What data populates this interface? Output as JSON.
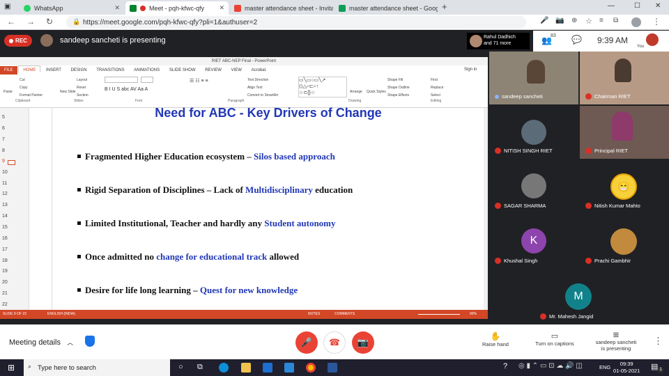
{
  "browser": {
    "tabs": [
      {
        "label": "WhatsApp",
        "active": false
      },
      {
        "label": "Meet - pqh-kfwc-qfy",
        "active": true
      },
      {
        "label": "master attendance sheet - Invita",
        "active": false
      },
      {
        "label": "master attendance sheet - Goog",
        "active": false
      }
    ],
    "url": "https://meet.google.com/pqh-kfwc-qfy?pli=1&authuser=2",
    "new_tab_symbol": "+"
  },
  "meet_top": {
    "rec_label": "REC",
    "presenting_text": "sandeep sancheti is presenting",
    "others_line1": "Rahul Dadhich",
    "others_line2": "and 71 more",
    "participant_count": "83",
    "time": "9:39 AM",
    "you_label": "You"
  },
  "powerpoint": {
    "window_title": "RIET ABC-NEP Final - PowerPoint",
    "sign_in": "Sign in",
    "ribbon_tabs": [
      "FILE",
      "HOME",
      "INSERT",
      "DESIGN",
      "TRANSITIONS",
      "ANIMATIONS",
      "SLIDE SHOW",
      "REVIEW",
      "VIEW",
      "Acrobat"
    ],
    "groups": [
      "Clipboard",
      "Slides",
      "Font",
      "Paragraph",
      "Drawing",
      "Editing"
    ],
    "clipboard_items": [
      "Paste",
      "Cut",
      "Copy",
      "Format Painter"
    ],
    "slides_items": [
      "New Slide",
      "Layout",
      "Reset",
      "Section"
    ],
    "paragraph_items": [
      "Text Direction",
      "Align Text",
      "Convert to SmartArt"
    ],
    "drawing_items": [
      "Arrange",
      "Quick Styles",
      "Shape Fill",
      "Shape Outline",
      "Shape Effects"
    ],
    "editing_items": [
      "Find",
      "Replace",
      "Select"
    ],
    "thumb_numbers": [
      "5",
      "6",
      "7",
      "8",
      "9",
      "10",
      "11",
      "12",
      "13",
      "14",
      "15",
      "16",
      "17",
      "18",
      "19",
      "20",
      "21",
      "22"
    ],
    "slide": {
      "title": "Need for ABC - Key Drivers of Change",
      "bullets": [
        {
          "plain": "Fragmented Higher Education ecosystem – ",
          "highlight": "Silos based approach",
          "after": ""
        },
        {
          "plain": "Rigid Separation of Disciplines – Lack of ",
          "highlight": "Multidisciplinary",
          "after": " education"
        },
        {
          "plain": "Limited Institutional, Teacher and hardly any ",
          "highlight": "Student autonomy",
          "after": ""
        },
        {
          "plain": "Once admitted no ",
          "highlight": "change for educational track",
          "after": " allowed"
        },
        {
          "plain": "Desire for life long learning – ",
          "highlight": "Quest for new knowledge",
          "after": ""
        }
      ]
    },
    "status": {
      "slide_of": "SLIDE 9 OF 23",
      "language": "ENGLISH (INDIA)",
      "notes": "NOTES",
      "comments": "COMMENTS",
      "zoom": "90%"
    }
  },
  "participants": [
    {
      "name": "sandeep sancheti",
      "muted": false,
      "avatar": "video"
    },
    {
      "name": "Chairman RIET",
      "muted": true,
      "avatar": "video"
    },
    {
      "name": "NITISH SINGH RIET",
      "muted": true,
      "avatar": "photo"
    },
    {
      "name": "Principal RIET",
      "muted": true,
      "avatar": "video"
    },
    {
      "name": "SAGAR SHARMA",
      "muted": true,
      "avatar": "photo"
    },
    {
      "name": "Nitish Kumar Mahto",
      "muted": true,
      "avatar": "emoji"
    },
    {
      "name": "Khushal Singh",
      "muted": true,
      "avatar": "letter",
      "letter": "K",
      "color": "#8e44ad"
    },
    {
      "name": "Prachi Gambhir",
      "muted": true,
      "avatar": "photo"
    },
    {
      "name": "Mr. Mahesh Jangid",
      "muted": true,
      "avatar": "letter",
      "letter": "M",
      "color": "#12828a"
    }
  ],
  "bottom": {
    "meeting_details": "Meeting details",
    "raise_hand": "Raise hand",
    "captions": "Turn on captions",
    "presenting_line1": "sandeep sancheti",
    "presenting_line2": "is presenting"
  },
  "taskbar": {
    "search_placeholder": "Type here to search",
    "lang": "ENG",
    "time": "09:39",
    "date": "01-05-2021",
    "notification_count": "1"
  },
  "colors": {
    "slide_blue": "#2137b5",
    "ppt_orange": "#d24726",
    "meet_red": "#ea4335"
  }
}
